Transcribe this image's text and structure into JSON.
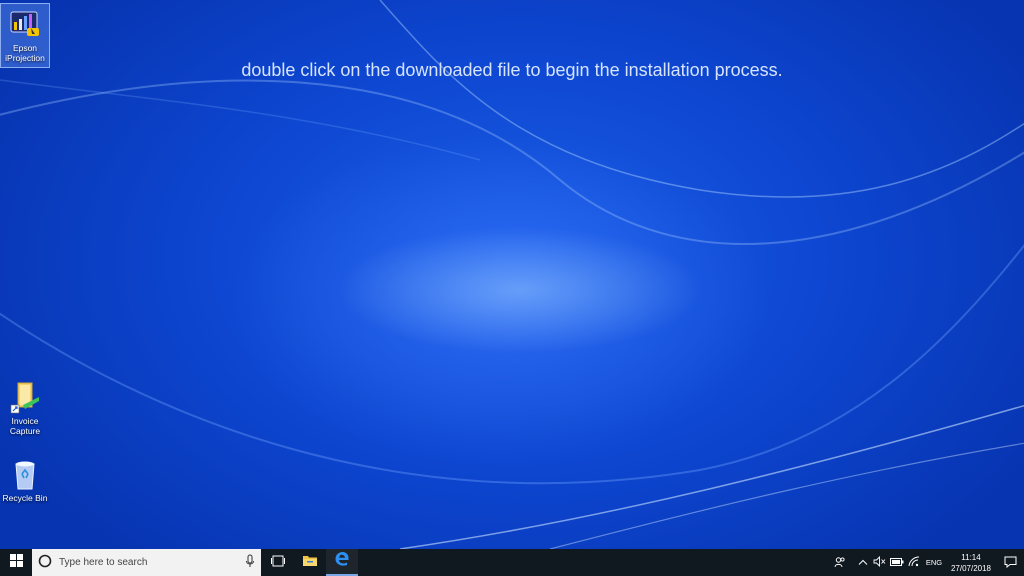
{
  "caption": "double click on the downloaded file to begin the installation process.",
  "desktop_icons": [
    {
      "label_line1": "Epson",
      "label_line2": "iProjection",
      "icon": "epson-iprojection-icon",
      "selected": true
    },
    {
      "label_line1": "Invoice",
      "label_line2": "Capture",
      "icon": "invoice-capture-shortcut-icon"
    },
    {
      "label_line1": "Recycle Bin",
      "label_line2": "",
      "icon": "recycle-bin-icon"
    }
  ],
  "taskbar": {
    "start_icon": "windows-logo-icon",
    "search_placeholder": "Type here to search",
    "search_icon": "cortana-circle-icon",
    "mic_icon": "microphone-icon",
    "taskview_icon": "task-view-icon",
    "pinned": [
      {
        "name": "file-explorer",
        "icon": "folder-icon"
      },
      {
        "name": "edge",
        "icon": "edge-icon",
        "active": true
      }
    ],
    "tray": {
      "people_icon": "people-icon",
      "chevron_icon": "chevron-up-icon",
      "volume_icon": "volume-muted-icon",
      "battery_icon": "battery-icon",
      "wifi_icon": "wifi-icon",
      "language": "ENG",
      "time": "11:14",
      "date": "27/07/2018",
      "notification_icon": "action-center-icon"
    }
  },
  "colors": {
    "wallpaper": "#0d45cf",
    "taskbar": "#101820",
    "caption_text": "#d6e4ff"
  }
}
